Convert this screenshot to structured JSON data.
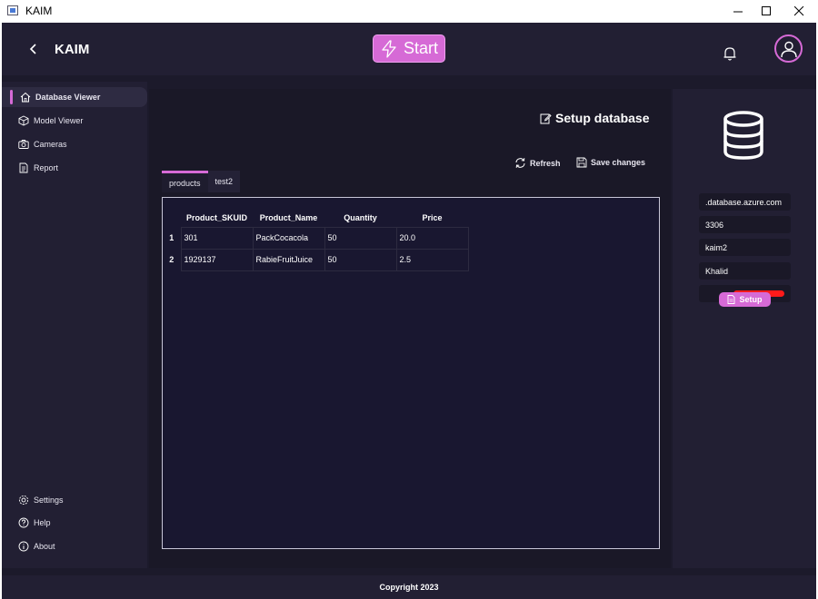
{
  "window": {
    "title": "KAIM"
  },
  "header": {
    "brand": "KAIM",
    "start_label": "Start"
  },
  "sidebar": {
    "items": [
      {
        "label": "Database Viewer",
        "icon": "home-icon"
      },
      {
        "label": "Model Viewer",
        "icon": "cube-icon"
      },
      {
        "label": "Cameras",
        "icon": "camera-icon"
      },
      {
        "label": "Report",
        "icon": "document-icon"
      }
    ],
    "bottom_items": [
      {
        "label": "Settings",
        "icon": "gear-icon"
      },
      {
        "label": "Help",
        "icon": "question-icon"
      },
      {
        "label": "About",
        "icon": "info-icon"
      }
    ]
  },
  "main": {
    "title": "Setup database",
    "refresh_label": "Refresh",
    "save_label": "Save changes",
    "tabs": [
      {
        "label": "products",
        "active": true
      },
      {
        "label": "test2",
        "active": false
      }
    ],
    "table": {
      "columns": [
        "Product_SKUID",
        "Product_Name",
        "Quantity",
        "Price"
      ],
      "rows": [
        {
          "num": "1",
          "cells": [
            "301",
            "PackCocacola",
            "50",
            "20.0"
          ]
        },
        {
          "num": "2",
          "cells": [
            "1929137",
            "RabieFruitJuice",
            "50",
            "2.5"
          ]
        }
      ]
    }
  },
  "connection": {
    "server": ".database.azure.com",
    "port": "3306",
    "database": "kaim2",
    "user": "Khalid",
    "setup_label": "Setup"
  },
  "footer": {
    "copyright": "Copyright 2023"
  },
  "colors": {
    "accent": "#d66ad6",
    "background": "#1c1a2b",
    "panel": "#221f33"
  }
}
